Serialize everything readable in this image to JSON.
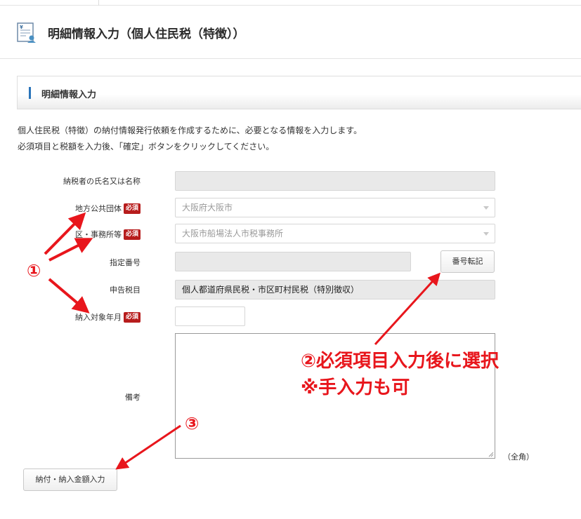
{
  "header": {
    "title": "明細情報入力（個人住民税（特徴））"
  },
  "panel": {
    "title": "明細情報入力"
  },
  "intro": {
    "line1": "個人住民税（特徴）の納付情報発行依頼を作成するために、必要となる情報を入力します。",
    "line2": "必須項目と税額を入力後、「確定」ボタンをクリックしてください。"
  },
  "form": {
    "required_badge": "必須",
    "taxpayer_name": {
      "label": "納税者の氏名又は名称",
      "value": ""
    },
    "local_government": {
      "label": "地方公共団体",
      "value": "大阪府大阪市"
    },
    "district_office": {
      "label": "区・事務所等",
      "value": "大阪市船場法人市税事務所"
    },
    "designated_number": {
      "label": "指定番号",
      "value": ""
    },
    "transfer_button": "番号転記",
    "tax_item": {
      "label": "申告税目",
      "value": "個人都道府県民税・市区町村民税（特別徴収）"
    },
    "target_month": {
      "label": "納入対象年月",
      "value": ""
    },
    "remarks": {
      "label": "備考",
      "note": "（全角）"
    },
    "amount_button": "納付・納入金額入力"
  },
  "annotations": {
    "one": "①",
    "two_line1": "②必須項目入力後に選択",
    "two_line2": "※手入力も可",
    "three": "③",
    "color": "#e8161c"
  }
}
